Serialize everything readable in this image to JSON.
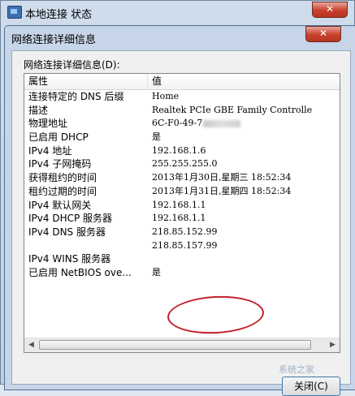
{
  "outer_window": {
    "title": "本地连接 状态",
    "close_label": "✕"
  },
  "dialog": {
    "title": "网络连接详细信息",
    "close_label": "✕",
    "group_label": "网络连接详细信息(D):",
    "columns": {
      "property": "属性",
      "value": "值"
    },
    "rows": [
      {
        "property": "连接特定的 DNS 后缀",
        "value": "Home"
      },
      {
        "property": "描述",
        "value": "Realtek PCIe GBE Family Controlle"
      },
      {
        "property": "物理地址",
        "value": "6C-F0-49-7"
      },
      {
        "property": "已启用 DHCP",
        "value": "是"
      },
      {
        "property": "IPv4 地址",
        "value": "192.168.1.6"
      },
      {
        "property": "IPv4 子网掩码",
        "value": "255.255.255.0"
      },
      {
        "property": "获得租约的时间",
        "value": "2013年1月30日,星期三 18:52:34"
      },
      {
        "property": "租约过期的时间",
        "value": "2013年1月31日,星期四 18:52:34"
      },
      {
        "property": "IPv4 默认网关",
        "value": "192.168.1.1"
      },
      {
        "property": "IPv4 DHCP 服务器",
        "value": "192.168.1.1"
      },
      {
        "property": "IPv4 DNS 服务器",
        "value": "218.85.152.99"
      },
      {
        "property": "",
        "value": "218.85.157.99"
      },
      {
        "property": "IPv4 WINS 服务器",
        "value": ""
      },
      {
        "property": "已启用 NetBIOS ove...",
        "value": "是"
      }
    ],
    "close_button": "关闭(C)"
  },
  "watermark": "系统之家",
  "colors": {
    "annotation": "#c41f2a",
    "title_close": "#c7402b"
  }
}
